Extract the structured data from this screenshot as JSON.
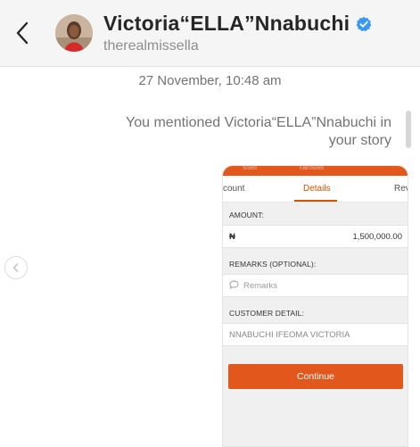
{
  "header": {
    "name": "Victoria“ELLA”Nnabuchi",
    "handle": "therealmissella",
    "verified_color": "#3897f0"
  },
  "thread": {
    "timestamp": "27 November, 10:48 am",
    "mention_text": "You mentioned Victoria“ELLA”Nnabuchi in your story"
  },
  "story": {
    "accent_color": "#e2581c",
    "tabs": {
      "left": "count",
      "active": "Details",
      "right": "Rev"
    },
    "amount_label": "AMOUNT:",
    "currency_symbol": "₦",
    "amount_value": "1,500,000.00",
    "remarks_label": "REMARKS (OPTIONAL):",
    "remarks_placeholder": "Remarks",
    "customer_label": "CUSTOMER DETAIL:",
    "customer_value": "NNABUCHI IFEOMA VICTORIA",
    "continue_label": "Continue"
  },
  "icons": {
    "back": "back-chevron-icon",
    "verified": "verified-badge-icon",
    "nav": "chevron-left-icon",
    "remarks": "chat-bubble-icon"
  }
}
